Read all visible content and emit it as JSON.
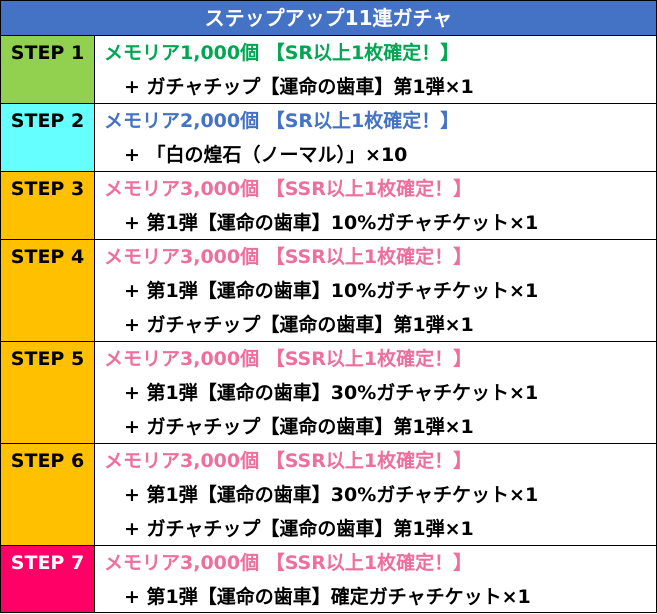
{
  "title": "ステップアップ11連ガチャ",
  "colors": {
    "header_bg": "#4472c4",
    "step_colors": [
      "#92d050",
      "#66ffff",
      "#ffc000",
      "#ffc000",
      "#ffc000",
      "#ffc000",
      "#ff0066"
    ],
    "text_green": "#00a651",
    "text_blue": "#4472c4",
    "text_pink": "#ee6f9c"
  },
  "steps": [
    {
      "label": "STEP 1",
      "main": "メモリア1,000個 【SR以上1枚確定！】",
      "bonuses": [
        "+ ガチャチップ【運命の歯車】第1弾×1"
      ]
    },
    {
      "label": "STEP 2",
      "main": "メモリア2,000個 【SR以上1枚確定！】",
      "bonuses": [
        "+ 「白の煌石（ノーマル）」×10"
      ]
    },
    {
      "label": "STEP 3",
      "main": "メモリア3,000個 【SSR以上1枚確定！】",
      "bonuses": [
        "+ 第1弾【運命の歯車】10%ガチャチケット×1"
      ]
    },
    {
      "label": "STEP 4",
      "main": "メモリア3,000個 【SSR以上1枚確定！】",
      "bonuses": [
        "+ 第1弾【運命の歯車】10%ガチャチケット×1",
        "+ ガチャチップ【運命の歯車】第1弾×1"
      ]
    },
    {
      "label": "STEP 5",
      "main": "メモリア3,000個 【SSR以上1枚確定！】",
      "bonuses": [
        "+ 第1弾【運命の歯車】30%ガチャチケット×1",
        "+ ガチャチップ【運命の歯車】第1弾×1"
      ]
    },
    {
      "label": "STEP 6",
      "main": "メモリア3,000個 【SSR以上1枚確定！】",
      "bonuses": [
        "+ 第1弾【運命の歯車】30%ガチャチケット×1",
        "+ ガチャチップ【運命の歯車】第1弾×1"
      ]
    },
    {
      "label": "STEP 7",
      "main": "メモリア3,000個 【SSR以上1枚確定！】",
      "bonuses": [
        "+ 第1弾【運命の歯車】確定ガチャチケット×1"
      ]
    }
  ]
}
